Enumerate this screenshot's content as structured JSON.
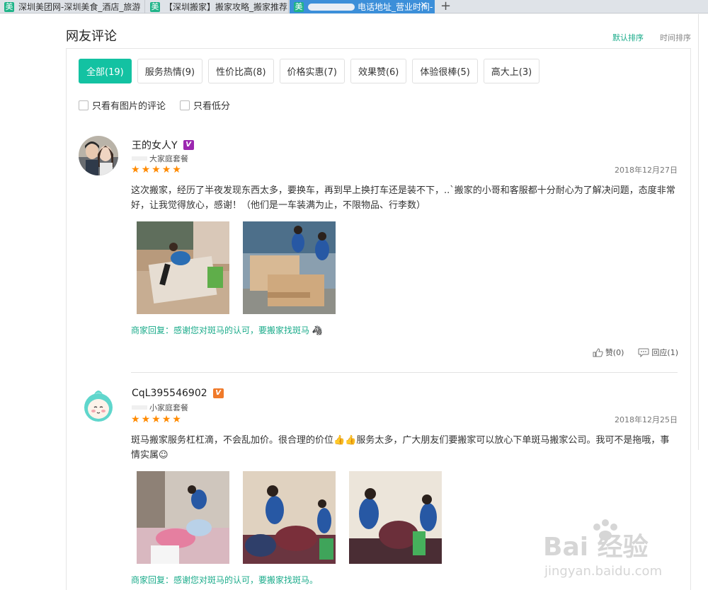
{
  "tabs": [
    {
      "label": "深圳美团网-深圳美食_酒店_旅游",
      "favicon": "美",
      "active": false
    },
    {
      "label": "【深圳搬家】搬家攻略_搬家推荐",
      "favicon": "美",
      "active": false
    },
    {
      "label": "电话地址_营业时间-",
      "favicon": "美",
      "active": true
    }
  ],
  "new_tab_label": "+",
  "close_tab_label": "×",
  "section": {
    "title": "网友评论",
    "sort_default": "默认排序",
    "sort_time": "时间排序"
  },
  "filters": [
    "全部(19)",
    "服务热情(9)",
    "性价比高(8)",
    "价格实惠(7)",
    "效果赞(6)",
    "体验很棒(5)",
    "高大上(3)"
  ],
  "checks": [
    "只看有图片的评论",
    "只看低分"
  ],
  "reviews": [
    {
      "user": "王的女人Y",
      "badge": "V",
      "badge_color": "#9c27b0",
      "package": "大家庭套餐",
      "stars": 5,
      "date": "2018年12月27日",
      "text": "这次搬家，经历了半夜发现东西太多，要换车，再到早上换打车还是装不下，..`搬家的小哥和客服都十分耐心为了解决问题，态度非常好，让我觉得放心，感谢！（他们是一车装满为止，不限物品、行李数）",
      "reply": "商家回复：感谢您对斑马的认可，要搬家找斑马",
      "like": "赞(0)",
      "comment": "回应(1)"
    },
    {
      "user": "CqL395546902",
      "badge": "V",
      "badge_color": "#f07a2a",
      "package": "小家庭套餐",
      "stars": 5,
      "date": "2018年12月25日",
      "text": "斑马搬家服务杠杠滴，不会乱加价。很合理的价位👍👍服务太多，广大朋友们要搬家可以放心下单斑马搬家公司。我可不是拖哦，事情实属☺",
      "reply": "商家回复：感谢您对斑马的认可，要搬家找斑马。"
    }
  ],
  "watermark": {
    "brand": "Bai 经验",
    "url": "jingyan.baidu.com"
  },
  "colors": {
    "accent": "#13c2a2",
    "star": "#ff8a00",
    "reply": "#1aab8a"
  }
}
